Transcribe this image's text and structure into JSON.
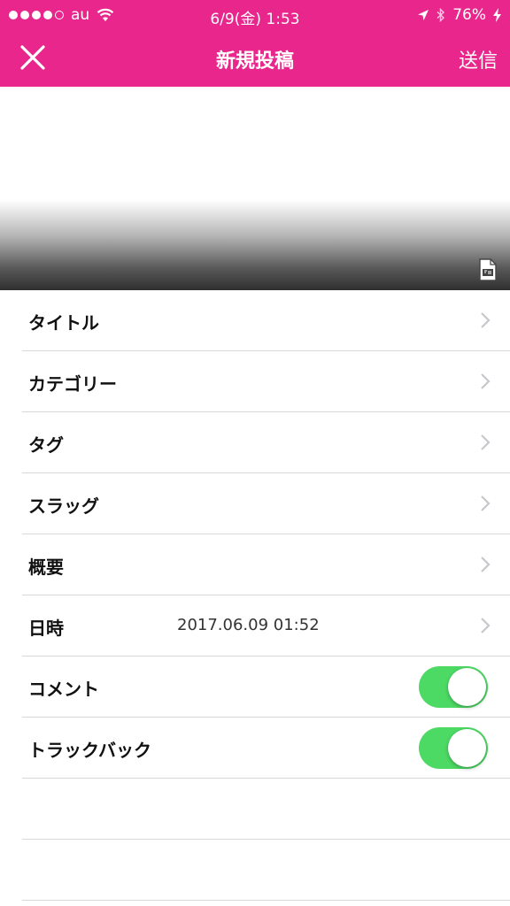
{
  "status_bar": {
    "carrier": "au",
    "time": "6/9(金) 1:53",
    "battery": "76%",
    "icons": [
      "signal-dots",
      "wifi-icon",
      "location-arrow-icon",
      "bluetooth-icon",
      "charging-bolt-icon"
    ]
  },
  "nav": {
    "close_icon": "close-icon",
    "title": "新規投稿",
    "send_label": "送信"
  },
  "colors": {
    "header_bg": "#e8268c",
    "toggle_on": "#4cd964",
    "divider": "#d8d8d8"
  },
  "preview": {
    "icon": "file-export-icon"
  },
  "settings": {
    "title": {
      "label": "タイトル"
    },
    "category": {
      "label": "カテゴリー"
    },
    "tags": {
      "label": "タグ"
    },
    "slug": {
      "label": "スラッグ"
    },
    "summary": {
      "label": "概要"
    },
    "datetime": {
      "label": "日時",
      "value": "2017.06.09 01:52"
    },
    "comments": {
      "label": "コメント",
      "enabled": true
    },
    "trackback": {
      "label": "トラックバック",
      "enabled": true
    }
  }
}
